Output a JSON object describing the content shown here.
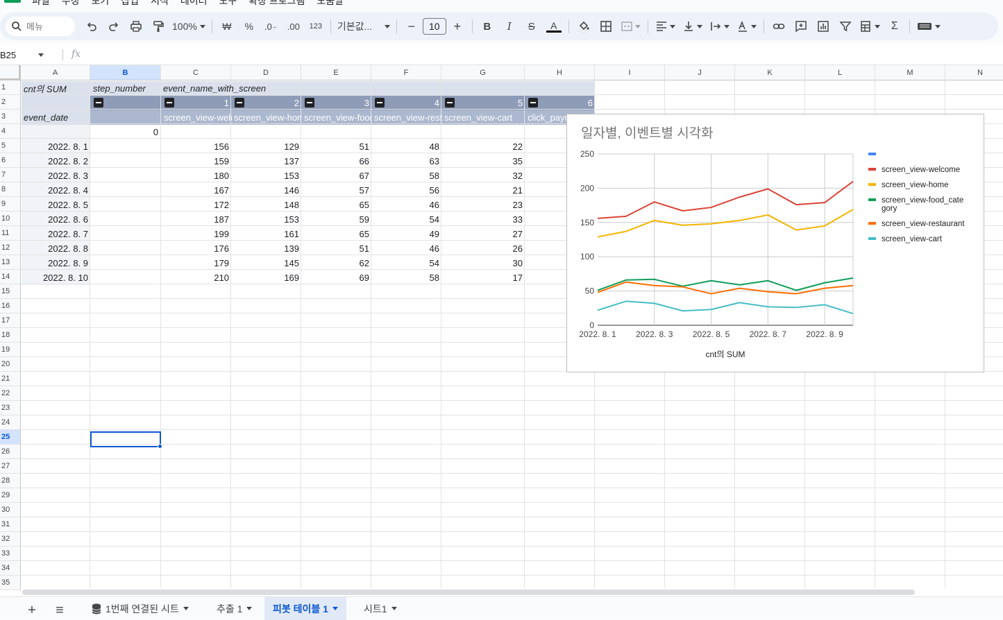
{
  "menubar": {
    "items": [
      "파일",
      "수정",
      "보기",
      "삽입",
      "서식",
      "데이터",
      "도구",
      "확장 프로그램",
      "도움말"
    ]
  },
  "toolbar": {
    "search_placeholder": "메뉴",
    "zoom": "100%",
    "currency": "₩",
    "percent": "%",
    "dec_decrease": ".0",
    "dec_increase": ".00",
    "number_format": "123",
    "font": "기본값...",
    "font_size": "10",
    "bold": "B",
    "italic": "I",
    "strikethrough": "S",
    "text_color": "A"
  },
  "formula_bar": {
    "name_box": "B25",
    "fx": "fx",
    "formula": ""
  },
  "grid": {
    "columns": [
      "A",
      "B",
      "C",
      "D",
      "E",
      "F",
      "G",
      "H",
      "I",
      "J",
      "K",
      "L",
      "M",
      "N"
    ],
    "selected_column": "B",
    "rows": [
      "1",
      "2",
      "3",
      "4",
      "5",
      "6",
      "7",
      "8",
      "9",
      "10",
      "11",
      "12",
      "13",
      "14",
      "15",
      "16",
      "17",
      "18",
      "19",
      "20",
      "21",
      "22",
      "23",
      "24",
      "25",
      "26",
      "27",
      "28",
      "29",
      "30",
      "31",
      "32",
      "33",
      "34",
      "35"
    ],
    "selected_row": "25"
  },
  "pivot": {
    "values_label": "cnt의 SUM",
    "col_field1": "step_number",
    "col_field2": "event_name_with_screen",
    "row_field": "event_date",
    "step_numbers": [
      "",
      "1",
      "2",
      "3",
      "4",
      "5",
      "6"
    ],
    "event_names": [
      "",
      "screen_view-welcome",
      "screen_view-home",
      "screen_view-food_category",
      "screen_view-restaurant",
      "screen_view-cart",
      "click_payment"
    ],
    "row4_b": "0",
    "rows": [
      {
        "date": "2022. 8. 1",
        "values": [
          "156",
          "129",
          "51",
          "48",
          "22"
        ]
      },
      {
        "date": "2022. 8. 2",
        "values": [
          "159",
          "137",
          "66",
          "63",
          "35"
        ]
      },
      {
        "date": "2022. 8. 3",
        "values": [
          "180",
          "153",
          "67",
          "58",
          "32"
        ]
      },
      {
        "date": "2022. 8. 4",
        "values": [
          "167",
          "146",
          "57",
          "56",
          "21"
        ]
      },
      {
        "date": "2022. 8. 5",
        "values": [
          "172",
          "148",
          "65",
          "46",
          "23"
        ]
      },
      {
        "date": "2022. 8. 6",
        "values": [
          "187",
          "153",
          "59",
          "54",
          "33"
        ]
      },
      {
        "date": "2022. 8. 7",
        "values": [
          "199",
          "161",
          "65",
          "49",
          "27"
        ]
      },
      {
        "date": "2022. 8. 8",
        "values": [
          "176",
          "139",
          "51",
          "46",
          "26"
        ]
      },
      {
        "date": "2022. 8. 9",
        "values": [
          "179",
          "145",
          "62",
          "54",
          "30"
        ]
      },
      {
        "date": "2022. 8. 10",
        "values": [
          "210",
          "169",
          "69",
          "58",
          "17"
        ]
      }
    ]
  },
  "chart_data": {
    "type": "line",
    "title": "일자별, 이벤트별 시각화",
    "xlabel": "cnt의 SUM",
    "ylabel": "",
    "ylim": [
      0,
      250
    ],
    "yticks": [
      "0",
      "50",
      "100",
      "150",
      "200",
      "250"
    ],
    "x": [
      "2022. 8. 1",
      "2022. 8. 2",
      "2022. 8. 3",
      "2022. 8. 4",
      "2022. 8. 5",
      "2022. 8. 6",
      "2022. 8. 7",
      "2022. 8. 8",
      "2022. 8. 9",
      "2022. 8. 10"
    ],
    "xtick_labels": [
      "2022. 8. 1",
      "2022. 8. 3",
      "2022. 8. 5",
      "2022. 8. 7",
      "2022. 8. 9"
    ],
    "legend_position": "right",
    "grid": true,
    "legend_blank_color": "#4285f4",
    "series": [
      {
        "name": "screen_view-welcome",
        "color": "#db4437",
        "values": [
          156,
          159,
          180,
          167,
          172,
          187,
          199,
          176,
          179,
          210
        ]
      },
      {
        "name": "screen_view-home",
        "color": "#f4b400",
        "values": [
          129,
          137,
          153,
          146,
          148,
          153,
          161,
          139,
          145,
          169
        ]
      },
      {
        "name": "screen_view-food_category",
        "legend_lines": [
          "screen_view-food_cate",
          "gory"
        ],
        "color": "#0f9d58",
        "values": [
          51,
          66,
          67,
          57,
          65,
          59,
          65,
          51,
          62,
          69
        ]
      },
      {
        "name": "screen_view-restaurant",
        "color": "#ff6d01",
        "values": [
          48,
          63,
          58,
          56,
          46,
          54,
          49,
          46,
          54,
          58
        ]
      },
      {
        "name": "screen_view-cart",
        "color": "#46bdc6",
        "values": [
          22,
          35,
          32,
          21,
          23,
          33,
          27,
          26,
          30,
          17
        ]
      }
    ]
  },
  "sheets": {
    "add": "+",
    "list": "≡",
    "tabs": [
      {
        "label": "1번째 연결된 시트",
        "active": false
      },
      {
        "label": "추출 1",
        "active": false
      },
      {
        "label": "피봇 테이블 1",
        "active": true
      },
      {
        "label": "시트1",
        "active": false
      }
    ]
  }
}
